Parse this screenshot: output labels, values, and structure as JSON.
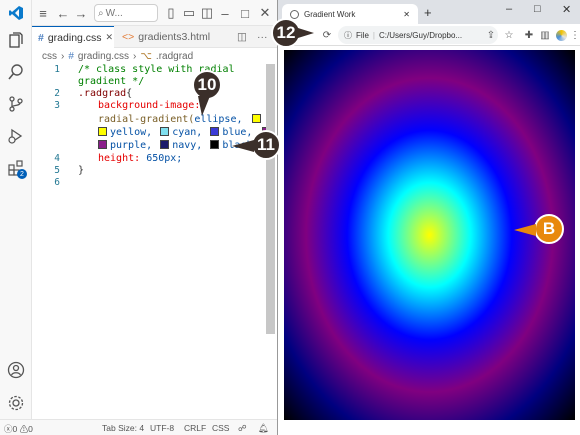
{
  "vscode": {
    "title_search": "W...",
    "tabs": [
      {
        "label": "grading.css",
        "glyph": "#"
      },
      {
        "label": "gradients3.html",
        "glyph": "<>"
      }
    ],
    "more_label": "···",
    "breadcrumb": {
      "folder": "css",
      "file": "grading.css",
      "symbol": ".radgrad"
    },
    "line_numbers": [
      "1",
      "2",
      "3",
      "4",
      "5",
      "6"
    ],
    "code": {
      "l1a": "/* class style with radial",
      "l1b": "gradient */",
      "l2_sel": ".radgrad",
      "l2_brace": "{",
      "l3_prop": "background-image:",
      "l3b_fn": "radial-gradient(",
      "l3b_arg": "ellipse,",
      "l3c_yellow": "yellow,",
      "l3c_cyan": "cyan,",
      "l3c_blue": "blue,",
      "l3d_purple": "purple,",
      "l3d_navy": "navy,",
      "l3d_black": "black);",
      "l4_prop": "height:",
      "l4_val": "650px;",
      "l5": "}"
    },
    "status": {
      "errors": "0",
      "warnings": "0",
      "tab_size": "Tab Size: 4",
      "encoding": "UTF-8",
      "eol": "CRLF",
      "language": "CSS"
    },
    "extensions_badge": "2"
  },
  "chrome": {
    "tab_title": "Gradient Work",
    "new_tab": "+",
    "url_scheme": "File",
    "url": "C:/Users/Guy/Dropbo..."
  },
  "callouts": {
    "c10": "10",
    "c11": "11",
    "c12": "12",
    "cb": "B"
  },
  "colors": {
    "swatch_yellow": "#ffff00",
    "swatch_cyan": "#7fdfef",
    "swatch_blue": "#3a3ad6",
    "swatch_purple": "#8a1e8a",
    "swatch_navy": "#1a1a6a",
    "swatch_black": "#000000",
    "callout_orange": "#e8890c",
    "callout_dark": "#3b2f2a",
    "accent": "#005fb8"
  },
  "icons": [
    "vscode-logo-icon",
    "menu-icon",
    "back-arrow-icon",
    "forward-arrow-icon",
    "search-icon",
    "layout-icon",
    "minimize-icon",
    "maximize-icon",
    "close-icon",
    "explorer-icon",
    "activity-search-icon",
    "source-control-icon",
    "run-debug-icon",
    "extensions-icon",
    "account-icon",
    "settings-gear-icon",
    "globe-icon",
    "reload-icon",
    "info-icon",
    "share-icon",
    "star-icon",
    "puzzle-icon",
    "sidebar-icon",
    "profile-icon",
    "kebab-menu-icon"
  ]
}
